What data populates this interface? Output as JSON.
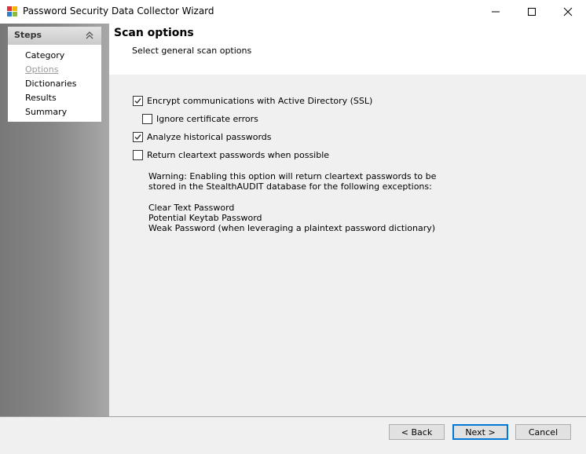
{
  "window": {
    "title": "Password Security Data Collector Wizard"
  },
  "steps": {
    "title": "Steps",
    "items": [
      {
        "label": "Category",
        "active": true
      },
      {
        "label": "Options",
        "active": false
      },
      {
        "label": "Dictionaries",
        "active": true
      },
      {
        "label": "Results",
        "active": true
      },
      {
        "label": "Summary",
        "active": true
      }
    ]
  },
  "header": {
    "title": "Scan options",
    "subtitle": "Select general scan options"
  },
  "options": [
    {
      "label": "Encrypt communications with Active Directory (SSL)",
      "checked": true
    },
    {
      "label": "Ignore certificate errors",
      "checked": false
    },
    {
      "label": "Analyze historical passwords",
      "checked": true
    },
    {
      "label": "Return cleartext passwords when possible",
      "checked": false
    }
  ],
  "warning": {
    "line1": "Warning: Enabling this option will return cleartext passwords to be",
    "line2": "stored in the StealthAUDIT database for the following exceptions:",
    "exceptions": [
      "Clear Text Password",
      "Potential Keytab Password",
      "Weak Password (when leveraging a plaintext password dictionary)"
    ]
  },
  "buttons": {
    "back": "< Back",
    "next": "Next >",
    "cancel": "Cancel"
  },
  "colors": {
    "accent": "#0078d7",
    "checkmark": "#333333"
  }
}
